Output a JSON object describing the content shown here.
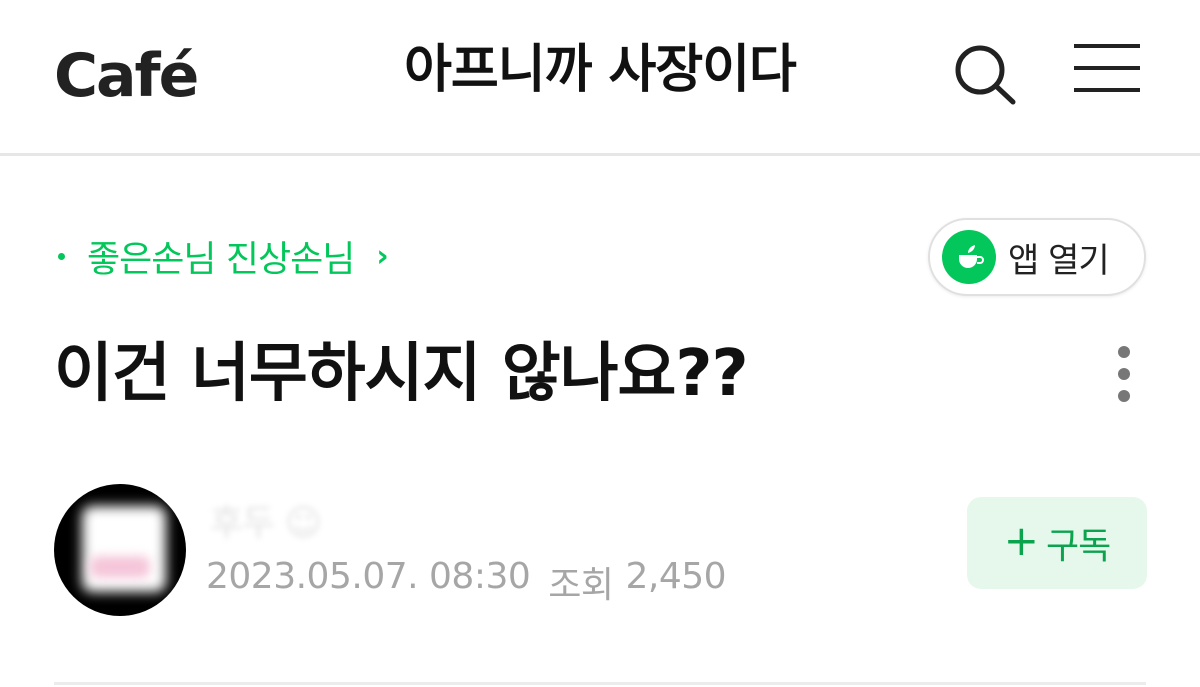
{
  "header": {
    "logo_text": "Café",
    "cafe_name": "아프니까 사장이다"
  },
  "board": {
    "name": "좋은손님 진상손님",
    "chevron": "›"
  },
  "app_open": {
    "label": "앱 열기"
  },
  "post": {
    "title": "이건 너무하시지 않나요??",
    "author_name": "후두 ☺",
    "date": "2023.05.07. 08:30",
    "views_label": "조회",
    "views": "2,450"
  },
  "subscribe": {
    "plus": "+",
    "label": "구독"
  },
  "colors": {
    "brand_green": "#03c75a",
    "meta_gray": "#a6a6a6",
    "subscribe_bg": "#e6f8ec"
  },
  "icons": {
    "search": "search-icon",
    "menu": "hamburger-menu-icon",
    "more": "more-vertical-icon",
    "app": "cafe-app-icon"
  }
}
